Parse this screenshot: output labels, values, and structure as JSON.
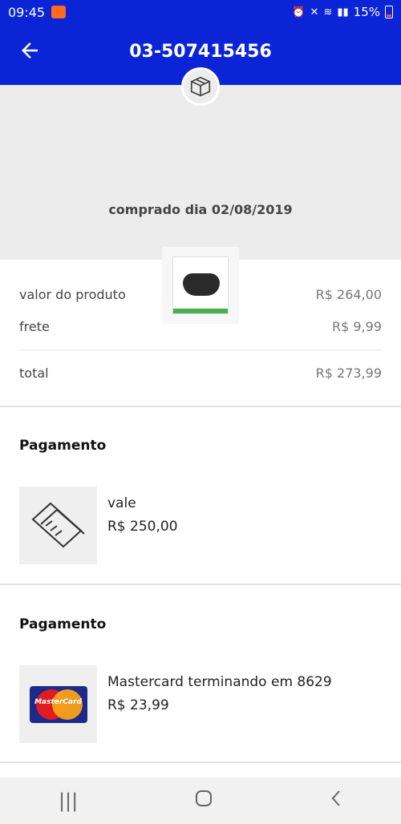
{
  "status_bar": {
    "time": "09:45",
    "battery_percent": "15%"
  },
  "app_bar": {
    "title": "03-507415456"
  },
  "order": {
    "purchased_text": "comprado dia 02/08/2019"
  },
  "summary": {
    "rows": [
      {
        "label": "valor do produto",
        "value": "R$ 264,00"
      },
      {
        "label": "frete",
        "value": "R$ 9,99"
      }
    ],
    "total": {
      "label": "total",
      "value": "R$ 273,99"
    }
  },
  "payments": [
    {
      "title": "Pagamento",
      "method": "vale",
      "amount": "R$ 250,00",
      "icon": "voucher-icon"
    },
    {
      "title": "Pagamento",
      "method": "Mastercard terminando em 8629",
      "amount": "R$ 23,99",
      "icon": "mastercard-logo",
      "logo_text": "MasterCard"
    }
  ],
  "colors": {
    "accent": "#0a24d6",
    "header_bg": "#ececec"
  }
}
